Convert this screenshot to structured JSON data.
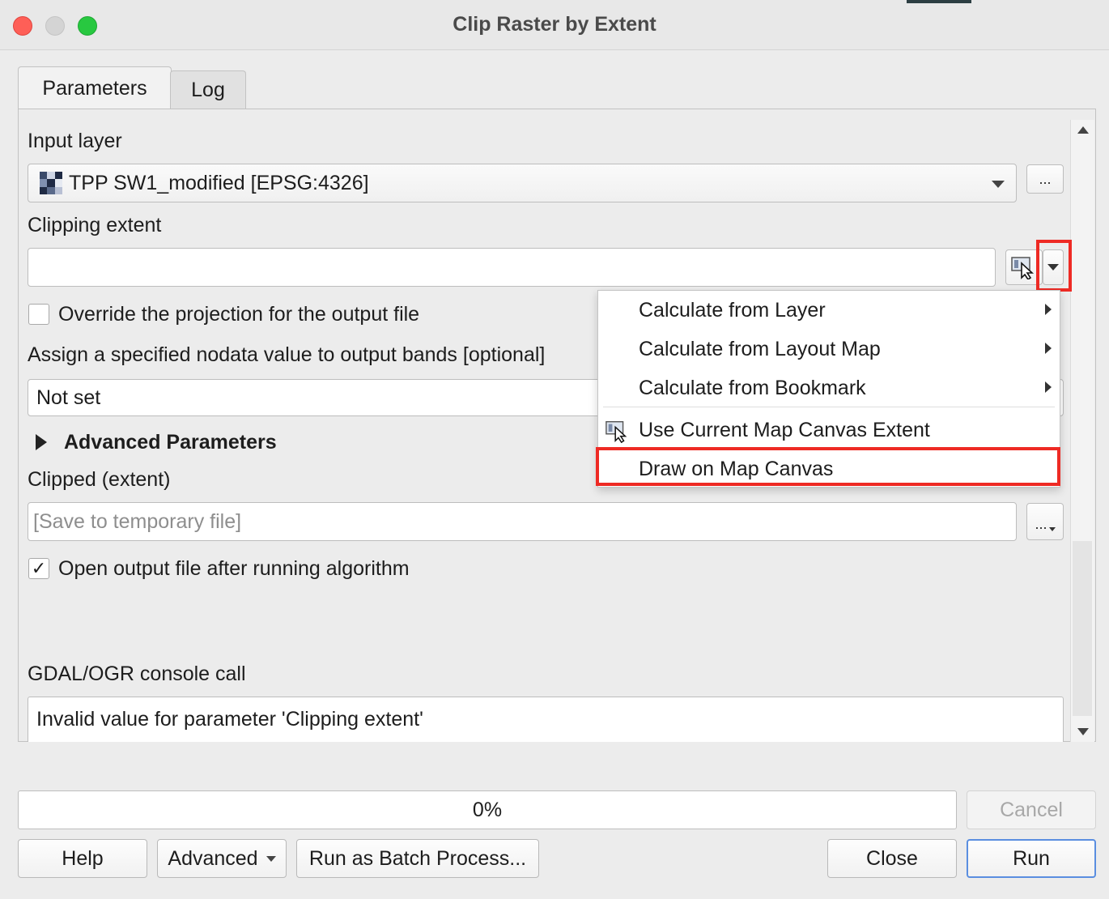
{
  "window": {
    "title": "Clip Raster by Extent"
  },
  "tabs": [
    {
      "label": "Parameters",
      "active": true
    },
    {
      "label": "Log",
      "active": false
    }
  ],
  "form": {
    "input_layer": {
      "label": "Input layer",
      "value": "TPP SW1_modified [EPSG:4326]",
      "browse_label": "..."
    },
    "clipping_extent": {
      "label": "Clipping extent",
      "value": ""
    },
    "override_projection": {
      "label": "Override the projection for the output file",
      "checked": false
    },
    "nodata": {
      "label": "Assign a specified nodata value to output bands [optional]",
      "value": "Not set"
    },
    "advanced_parameters": {
      "label": "Advanced Parameters"
    },
    "clipped_output": {
      "label": "Clipped (extent)",
      "placeholder": "[Save to temporary file]",
      "browse_label": "..."
    },
    "open_output": {
      "label": "Open output file after running algorithm",
      "checked": true,
      "check_glyph": "✓"
    },
    "console": {
      "label": "GDAL/OGR console call",
      "value": "Invalid value for parameter 'Clipping extent'"
    }
  },
  "extent_menu": {
    "items": [
      {
        "label": "Calculate from Layer",
        "submenu": true
      },
      {
        "label": "Calculate from Layout Map",
        "submenu": true
      },
      {
        "label": "Calculate from Bookmark",
        "submenu": true
      },
      {
        "label": "Use Current Map Canvas Extent",
        "submenu": false,
        "icon": "map-canvas-cursor-icon"
      },
      {
        "label": "Draw on Map Canvas",
        "submenu": false,
        "highlighted": true
      }
    ]
  },
  "progress": {
    "value_text": "0%",
    "fraction": 0
  },
  "buttons": {
    "cancel": "Cancel",
    "help": "Help",
    "advanced": "Advanced",
    "batch": "Run as Batch Process...",
    "close": "Close",
    "run": "Run"
  },
  "colors": {
    "highlight": "#ee2a24",
    "default_button_border": "#5a8ee0"
  }
}
